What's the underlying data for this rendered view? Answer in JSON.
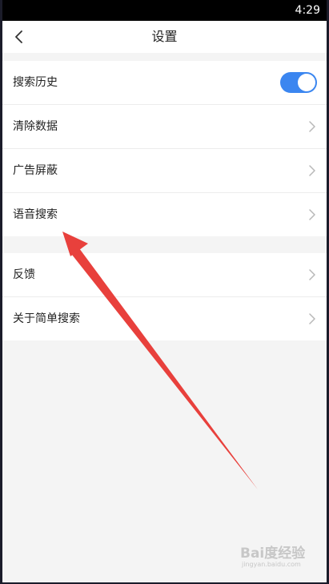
{
  "status_bar": {
    "time": "4:29"
  },
  "header": {
    "title": "设置"
  },
  "groups": [
    {
      "items": [
        {
          "label": "搜索历史",
          "control": "toggle",
          "on": true
        },
        {
          "label": "清除数据",
          "control": "chevron"
        },
        {
          "label": "广告屏蔽",
          "control": "chevron"
        },
        {
          "label": "语音搜索",
          "control": "chevron"
        }
      ]
    },
    {
      "items": [
        {
          "label": "反馈",
          "control": "chevron"
        },
        {
          "label": "关于简单搜索",
          "control": "chevron"
        }
      ]
    }
  ],
  "colors": {
    "accent": "#3b86f0",
    "annotation_arrow": "#e8403c",
    "background": "#f4f4f4"
  },
  "watermark": {
    "logo": "Bai度经验",
    "url": "jingyan.baidu.com"
  }
}
